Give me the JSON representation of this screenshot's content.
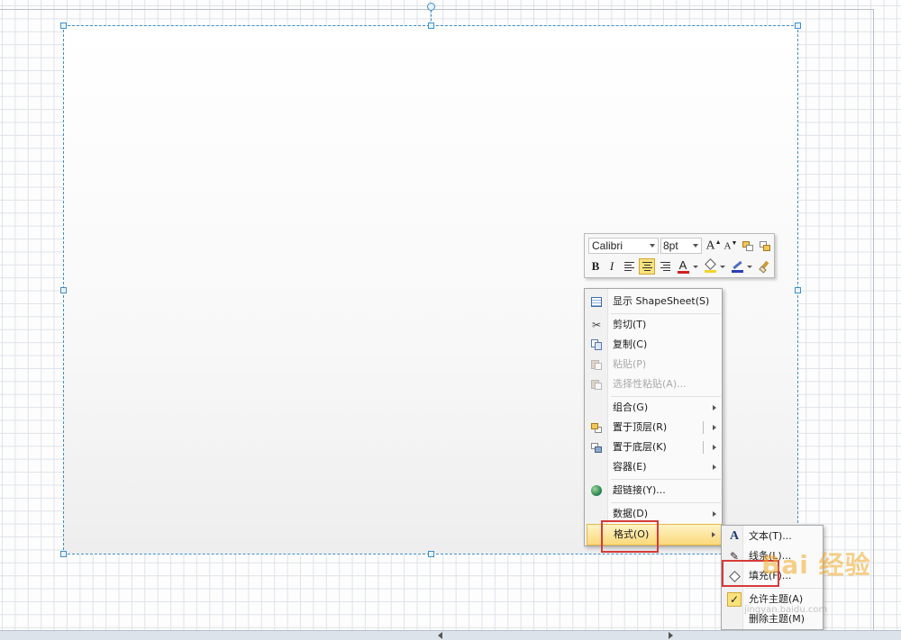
{
  "mini_toolbar": {
    "font_name": "Calibri",
    "font_size": "8pt",
    "bold": "B",
    "italic": "I",
    "font_color_glyph": "A",
    "grow_font_glyph": "A",
    "shrink_font_glyph": "A"
  },
  "context_menu": {
    "items": [
      {
        "label": "显示 ShapeSheet(S)",
        "icon": "shapesheet-icon",
        "enabled": true
      },
      {
        "label": "剪切(T)",
        "icon": "scissors-icon",
        "enabled": true
      },
      {
        "label": "复制(C)",
        "icon": "copy-icon",
        "enabled": true
      },
      {
        "label": "粘贴(P)",
        "icon": "paste-icon",
        "enabled": false
      },
      {
        "label": "选择性粘贴(A)...",
        "icon": "paste-special-icon",
        "enabled": false
      },
      {
        "label": "组合(G)",
        "icon": "",
        "enabled": true,
        "submenu": true
      },
      {
        "label": "置于顶层(R)",
        "icon": "bring-to-front-icon",
        "enabled": true,
        "submenu": true
      },
      {
        "label": "置于底层(K)",
        "icon": "send-to-back-icon",
        "enabled": true,
        "submenu": true
      },
      {
        "label": "容器(E)",
        "icon": "",
        "enabled": true,
        "submenu": true
      },
      {
        "label": "超链接(Y)...",
        "icon": "hyperlink-globe-icon",
        "enabled": true
      },
      {
        "label": "数据(D)",
        "icon": "",
        "enabled": true,
        "submenu": true
      },
      {
        "label": "格式(O)",
        "icon": "",
        "enabled": true,
        "submenu": true,
        "highlighted": true
      }
    ]
  },
  "format_submenu": {
    "items": [
      {
        "label": "文本(T)...",
        "icon": "text-a-icon"
      },
      {
        "label": "线条(L)...",
        "icon": "pen-icon"
      },
      {
        "label": "填充(F)...",
        "icon": "fill-bucket-icon"
      },
      {
        "label": "允许主题(A)",
        "icon": "checkmark-icon",
        "checked": true
      },
      {
        "label": "删除主题(M)",
        "icon": ""
      }
    ]
  },
  "watermark": {
    "text": "Bai 经验",
    "sub": "jingyan.baidu.com"
  },
  "colors": {
    "selection": "#3f8fc9",
    "highlight": "#fbd97a",
    "red_callout": "#d63a3a"
  }
}
